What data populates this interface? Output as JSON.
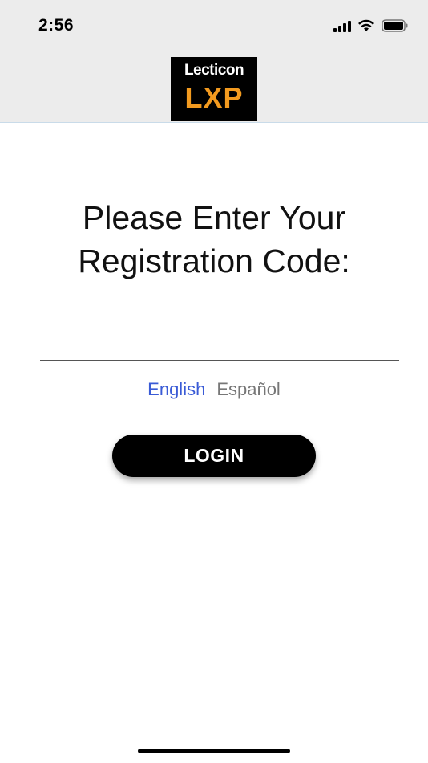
{
  "status_bar": {
    "time": "2:56",
    "icons": [
      "signal-icon",
      "wifi-icon",
      "battery-icon"
    ]
  },
  "header": {
    "logo_word": "Lecticon",
    "logo_sub": "LXP"
  },
  "main": {
    "prompt_line1": "Please Enter Your",
    "prompt_line2": "Registration Code:",
    "code_value": "",
    "code_placeholder": ""
  },
  "languages": {
    "english": "English",
    "espanol": "Español",
    "selected": "English"
  },
  "login_label": "LOGIN",
  "colors": {
    "header_bg": "#ececec",
    "language_selected": "#3a5bd6",
    "language_unselected": "#777777",
    "button_bg": "#000000",
    "logo_accent": "#f29a1f"
  }
}
